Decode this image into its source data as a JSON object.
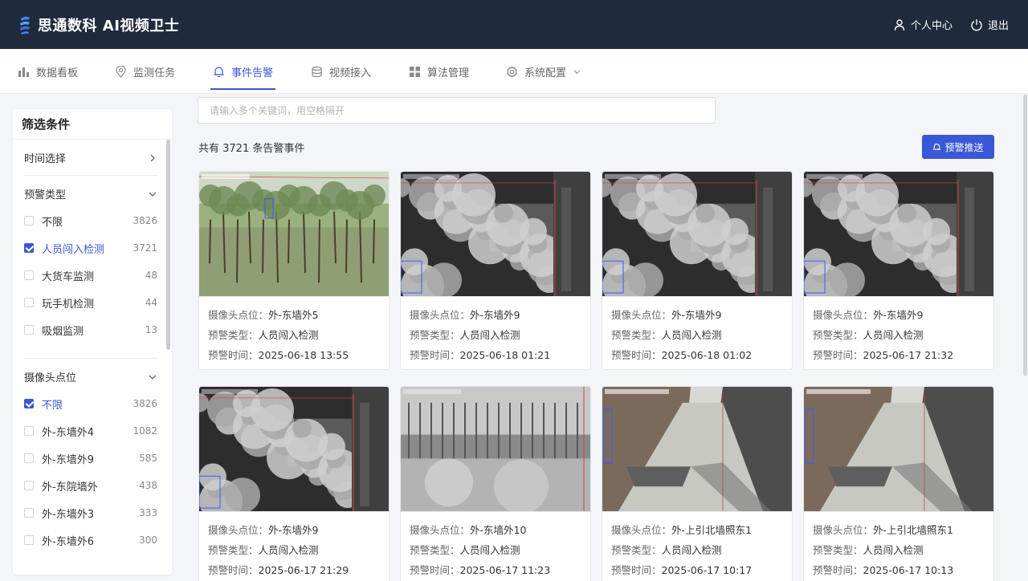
{
  "app": {
    "title": "思通数科 AI视频卫士"
  },
  "header": {
    "user_center": "个人中心",
    "logout": "退出"
  },
  "nav": [
    {
      "label": "数据看板",
      "icon": "bar-chart-icon"
    },
    {
      "label": "监测任务",
      "icon": "location-pin-icon"
    },
    {
      "label": "事件告警",
      "icon": "bell-icon",
      "active": true
    },
    {
      "label": "视频接入",
      "icon": "database-icon"
    },
    {
      "label": "算法管理",
      "icon": "grid-icon"
    },
    {
      "label": "系统配置",
      "icon": "gear-icon"
    }
  ],
  "filters": {
    "title": "筛选条件",
    "time_label": "时间选择",
    "alert_type": {
      "label": "预警类型",
      "options": [
        {
          "label": "不限",
          "count": "3826",
          "checked": false
        },
        {
          "label": "人员闯入检测",
          "count": "3721",
          "checked": true
        },
        {
          "label": "大货车监测",
          "count": "48",
          "checked": false
        },
        {
          "label": "玩手机检测",
          "count": "44",
          "checked": false
        },
        {
          "label": "吸烟监测",
          "count": "13",
          "checked": false
        }
      ]
    },
    "camera": {
      "label": "摄像头点位",
      "options": [
        {
          "label": "不限",
          "count": "3826",
          "checked": true
        },
        {
          "label": "外-东墙外4",
          "count": "1082",
          "checked": false
        },
        {
          "label": "外-东墙外9",
          "count": "585",
          "checked": false
        },
        {
          "label": "外-东院墙外",
          "count": "438",
          "checked": false
        },
        {
          "label": "外-东墙外3",
          "count": "333",
          "checked": false
        },
        {
          "label": "外-东墙外6",
          "count": "300",
          "checked": false
        }
      ]
    }
  },
  "search": {
    "placeholder": "请输入多个关键词，用空格隔开"
  },
  "summary": {
    "total_text": "共有 3721 条告警事件"
  },
  "push_button": {
    "label": "预警推送"
  },
  "field_labels": {
    "camera": "摄像头点位：",
    "type": "预警类型：",
    "time": "预警时间："
  },
  "events": [
    {
      "camera": "外-东墙外5",
      "type": "人员闯入检测",
      "time": "2025-06-18 13:55",
      "scene": "forest"
    },
    {
      "camera": "外-东墙外9",
      "type": "人员闯入检测",
      "time": "2025-06-18 01:21",
      "scene": "night-wall"
    },
    {
      "camera": "外-东墙外9",
      "type": "人员闯入检测",
      "time": "2025-06-18 01:02",
      "scene": "night-wall"
    },
    {
      "camera": "外-东墙外9",
      "type": "人员闯入检测",
      "time": "2025-06-17 21:32",
      "scene": "night-wall"
    },
    {
      "camera": "外-东墙外9",
      "type": "人员闯入检测",
      "time": "2025-06-17 21:29",
      "scene": "night-wall"
    },
    {
      "camera": "外-东墙外10",
      "type": "人员闯入检测",
      "time": "2025-06-17 11:23",
      "scene": "night-forest"
    },
    {
      "camera": "外-上引北墙照东1",
      "type": "人员闯入检测",
      "time": "2025-06-17 10:17",
      "scene": "alley"
    },
    {
      "camera": "外-上引北墙照东1",
      "type": "人员闯入检测",
      "time": "2025-06-17 10:13",
      "scene": "alley"
    }
  ],
  "colors": {
    "header_bg": "#1f2a3c",
    "accent": "#3a57d6"
  }
}
